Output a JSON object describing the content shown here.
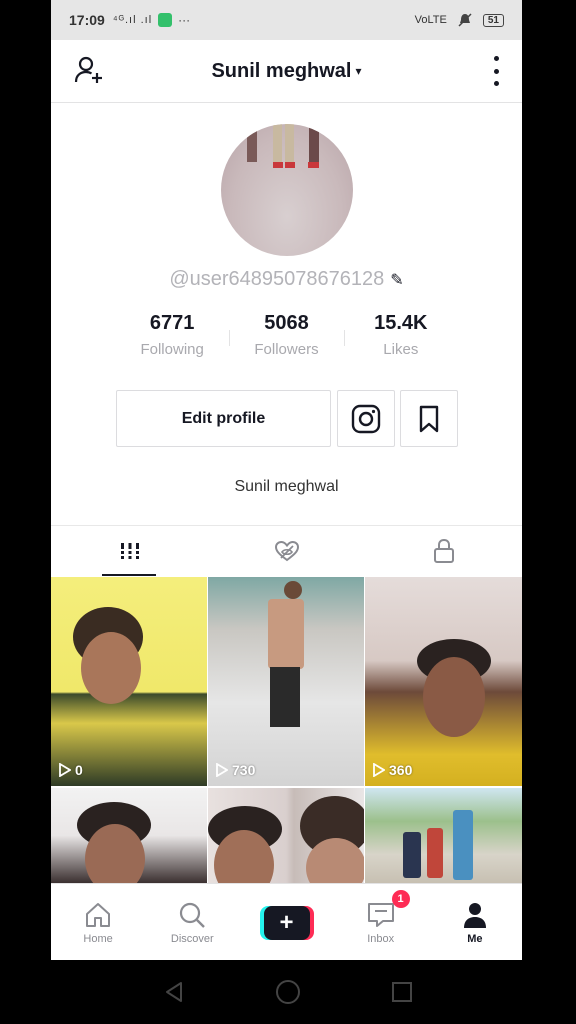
{
  "status_bar": {
    "time": "17:09",
    "signal_text": "⁴ᴳ.ıl .ıl",
    "dots": "···",
    "volte": "VoLTE",
    "battery": "51"
  },
  "header": {
    "title": "Sunil meghwal",
    "caret": "▾",
    "icons": {
      "add_user": "add-user-icon",
      "more": "more-vertical-icon"
    }
  },
  "profile": {
    "username": "@user64895078676128",
    "edit_icon": "✎",
    "stats": [
      {
        "value": "6771",
        "label": "Following"
      },
      {
        "value": "5068",
        "label": "Followers"
      },
      {
        "value": "15.4K",
        "label": "Likes"
      }
    ],
    "edit_profile_label": "Edit profile",
    "bio": "Sunil meghwal"
  },
  "tabs": [
    {
      "icon": "grid-icon",
      "active": true
    },
    {
      "icon": "liked-hidden-icon",
      "active": false
    },
    {
      "icon": "lock-icon",
      "active": false
    }
  ],
  "videos": [
    {
      "views": "0"
    },
    {
      "views": "730"
    },
    {
      "views": "360"
    }
  ],
  "bottom_nav": [
    {
      "label": "Home",
      "icon": "home-icon"
    },
    {
      "label": "Discover",
      "icon": "search-icon"
    },
    {
      "label": "",
      "icon": "create-plus-icon",
      "plus": "+"
    },
    {
      "label": "Inbox",
      "icon": "inbox-icon",
      "badge": "1"
    },
    {
      "label": "Me",
      "icon": "profile-icon"
    }
  ],
  "colors": {
    "accent_red": "#fe2c55",
    "accent_cyan": "#25f4ee",
    "text_dark": "#161823",
    "text_muted": "#a9a9ae"
  }
}
